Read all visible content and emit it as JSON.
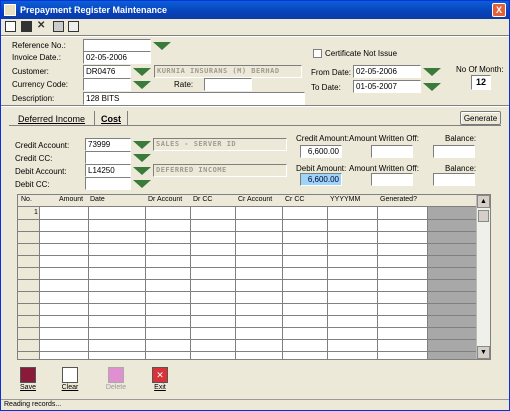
{
  "window": {
    "title": "Prepayment Register Maintenance",
    "close_glyph": "X"
  },
  "toolbar": {
    "icons": [
      "new-icon",
      "save-icon",
      "delete-icon",
      "print-icon",
      "list-icon"
    ]
  },
  "header": {
    "reference_no_label": "Reference No.:",
    "reference_no_value": "",
    "invoice_date_label": "Invoice Date.:",
    "invoice_date_value": "02-05-2006",
    "customer_label": "Customer:",
    "customer_code": "DR0476",
    "customer_name": "KURNIA INSURANS (M) BERHAD",
    "currency_label": "Currency Code:",
    "currency_value": "",
    "rate_label": "Rate:",
    "rate_value": "",
    "description_label": "Description:",
    "description_value": "128 BITS",
    "certificate_label": "Certificate Not Issue",
    "from_date_label": "From Date:",
    "from_date_value": "02-05-2006",
    "to_date_label": "To Date:",
    "to_date_value": "01-05-2007",
    "months_label": "No Of Month:",
    "months_value": "12"
  },
  "tabs": [
    {
      "label": "Deferred Income"
    },
    {
      "label": "Cost"
    }
  ],
  "generate_label": "Generate",
  "accounts": {
    "credit_account_label": "Credit Account:",
    "credit_account_value": "73999",
    "credit_account_name": "SALES - SERVER ID",
    "credit_cc_label": "Credit CC:",
    "credit_cc_value": "",
    "debit_account_label": "Debit Account:",
    "debit_account_value": "L14250",
    "debit_account_name": "DEFERRED INCOME",
    "debit_cc_label": "Debit CC:",
    "debit_cc_value": "",
    "credit_amount_label": "Credit Amount:",
    "credit_amount_value": "6,600.00",
    "credit_written_off_label": "Amount Written Off:",
    "credit_balance_label": "Balance:",
    "debit_amount_label": "Debit Amount:",
    "debit_amount_value": "6,600.00",
    "debit_written_off_label": "Amount Written Off:",
    "debit_balance_label": "Balance:"
  },
  "grid": {
    "columns": [
      "No.",
      "Amount",
      "Date",
      "Dr Account",
      "Dr CC",
      "Cr Account",
      "Cr CC",
      "YYYYMM",
      "Generated?"
    ],
    "first_row_no": "1"
  },
  "bottom_buttons": [
    {
      "label": "Save",
      "icon": "floppy-icon"
    },
    {
      "label": "Clear",
      "icon": "clear-page-icon"
    },
    {
      "label": "Delete",
      "icon": "eraser-icon"
    },
    {
      "label": "Exit",
      "icon": "exit-icon"
    }
  ],
  "status": "Reading records...",
  "colors": {
    "title_bar": "#0842b8",
    "arrow_green": "#3a7a3a",
    "grid_bg": "#a8a8a8",
    "selection": "#9ed4f8"
  }
}
